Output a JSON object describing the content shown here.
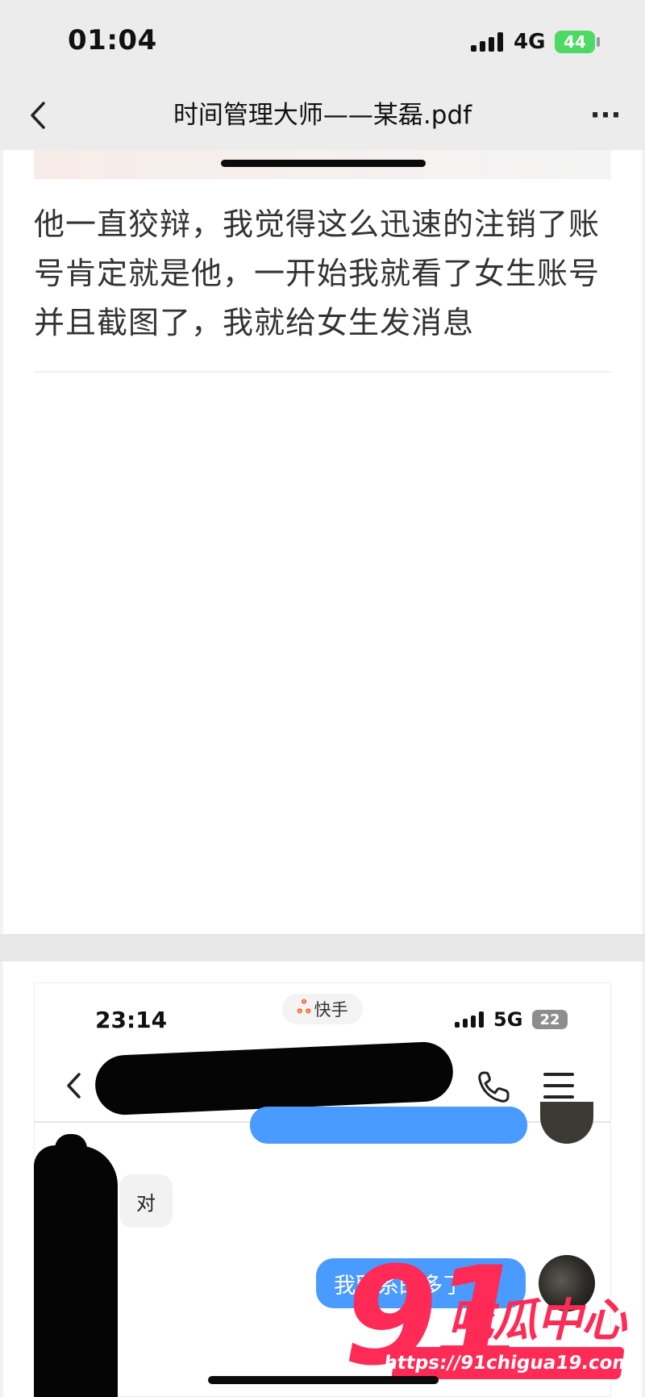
{
  "status_bar": {
    "time": "01:04",
    "network": "4G",
    "battery": "44"
  },
  "nav": {
    "back_icon": "chevron-left-icon",
    "title": "时间管理大师——某磊.pdf",
    "more_icon": "ellipsis-icon",
    "more_label": "···"
  },
  "document": {
    "paragraph": "他一直狡辩，我觉得这么迅速的注销了账号肯定就是他，一开始我就看了女生账号并且截图了，我就给女生发消息"
  },
  "embedded_screenshot": {
    "status_time": "23:14",
    "app_badge": "快手",
    "app_badge_icon": "kuaishou-icon",
    "network": "5G",
    "battery": "22",
    "reply_gray": "对",
    "bubble_self": "我联系的多了"
  },
  "watermark": {
    "number": "91",
    "name": "吃瓜中心",
    "url": "https://91chigua19.com"
  },
  "colors": {
    "accent_blue": "#4a9bff",
    "watermark_pink": "#ff2a55",
    "battery_green": "#4cd964"
  }
}
